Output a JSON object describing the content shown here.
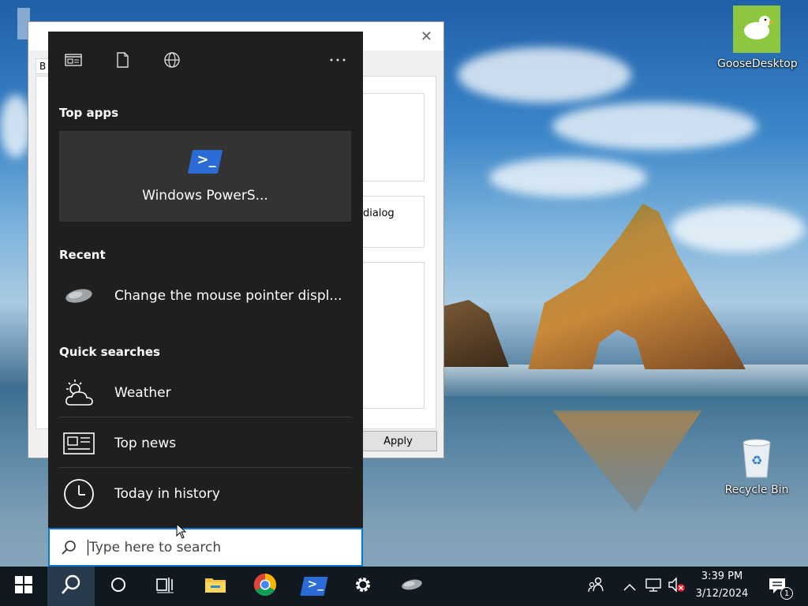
{
  "desktop": {
    "icons": [
      {
        "label": "GooseDesktop",
        "icon": "goose-icon"
      },
      {
        "label": "Recycle Bin",
        "icon": "recycle-bin-icon"
      }
    ]
  },
  "background_window": {
    "apply_label": "Apply",
    "dialog_fragment": "dialog",
    "tab_fragment": "B"
  },
  "search_flyout": {
    "top_icons": [
      "apps-filter-icon",
      "documents-filter-icon",
      "web-filter-icon",
      "more-options-icon"
    ],
    "top_apps_title": "Top apps",
    "top_app": {
      "label": "Windows PowerS...",
      "icon": "powershell-icon"
    },
    "recent_title": "Recent",
    "recent_items": [
      {
        "label": "Change the mouse pointer displ...",
        "icon": "mouse-icon"
      }
    ],
    "quick_searches_title": "Quick searches",
    "quick_searches": [
      {
        "label": "Weather",
        "icon": "weather-icon"
      },
      {
        "label": "Top news",
        "icon": "news-icon"
      },
      {
        "label": "Today in history",
        "icon": "clock-icon"
      }
    ],
    "search_placeholder": "Type here to search"
  },
  "taskbar": {
    "pinned": [
      "windows-start-icon",
      "search-icon",
      "cortana-icon",
      "task-view-icon",
      "file-explorer-icon",
      "chrome-icon",
      "powershell-icon",
      "settings-icon",
      "mouse-settings-icon"
    ],
    "tray": {
      "time": "3:39 PM",
      "date": "3/12/2024",
      "notification_count": "1"
    }
  },
  "colors": {
    "flyout_bg": "#1f1f1f",
    "accent": "#0a78d7",
    "taskbar_bg": "#101820"
  }
}
